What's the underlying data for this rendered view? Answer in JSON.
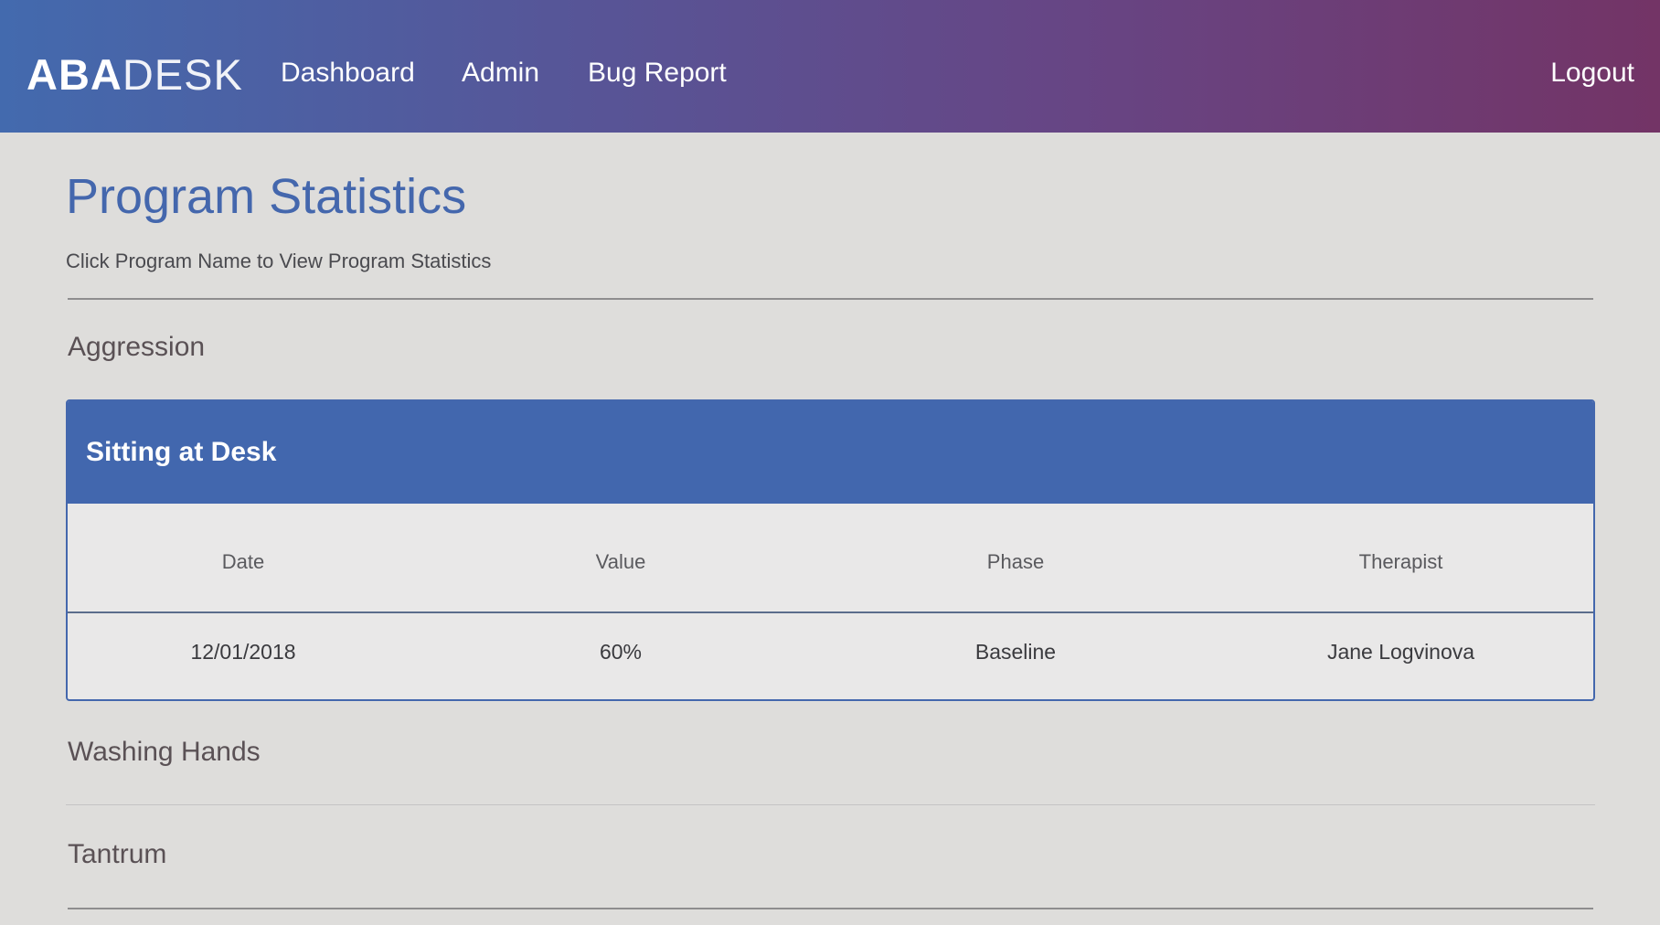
{
  "nav": {
    "brand_bold": "ABA",
    "brand_light": "DESK",
    "links": [
      "Dashboard",
      "Admin",
      "Bug Report"
    ],
    "logout": "Logout"
  },
  "page": {
    "title": "Program Statistics",
    "subtitle": "Click Program Name to View Program Statistics"
  },
  "programs": [
    {
      "name": "Aggression"
    },
    {
      "name": "Washing Hands"
    },
    {
      "name": "Tantrum"
    }
  ],
  "expanded_program": {
    "name": "Sitting at Desk",
    "columns": [
      "Date",
      "Value",
      "Phase",
      "Therapist"
    ],
    "rows": [
      {
        "date": "12/01/2018",
        "value": "60%",
        "phase": "Baseline",
        "therapist": "Jane Logvinova"
      }
    ]
  },
  "colors": {
    "accent": "#4467ad",
    "header_gradient_start": "#436aae",
    "header_gradient_end": "#733466",
    "background": "#dedddb"
  }
}
